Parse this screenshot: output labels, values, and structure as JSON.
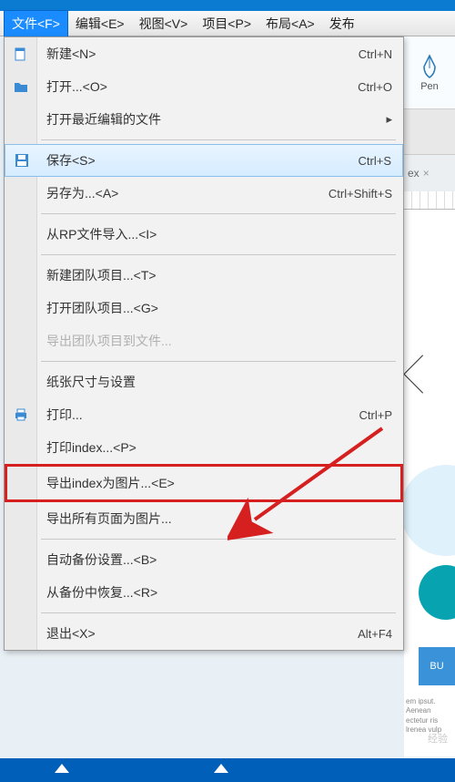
{
  "menubar": {
    "file": "文件<F>",
    "edit": "编辑<E>",
    "view": "视图<V>",
    "project": "项目<P>",
    "layout": "布局<A>",
    "publish": "发布"
  },
  "menu": {
    "new": "新建<N>",
    "new_sc": "Ctrl+N",
    "open": "打开...<O>",
    "open_sc": "Ctrl+O",
    "open_recent": "打开最近编辑的文件",
    "save": "保存<S>",
    "save_sc": "Ctrl+S",
    "save_as": "另存为...<A>",
    "save_as_sc": "Ctrl+Shift+S",
    "import_rp": "从RP文件导入...<I>",
    "new_team": "新建团队项目...<T>",
    "open_team": "打开团队项目...<G>",
    "export_team": "导出团队项目到文件...",
    "page_setup": "纸张尺寸与设置",
    "print": "打印...",
    "print_sc": "Ctrl+P",
    "print_index": "打印index...<P>",
    "export_index_img": "导出index为图片...<E>",
    "export_all_img": "导出所有页面为图片...",
    "auto_backup": "自动备份设置...<B>",
    "restore_backup": "从备份中恢复...<R>",
    "exit": "退出<X>",
    "exit_sc": "Alt+F4"
  },
  "right": {
    "pen": "Pen",
    "tab_suffix": "ex",
    "btn": "BU",
    "lorem": "em ipsut. Aenean ectetur ris lrenea vulp"
  },
  "watermark": "经验"
}
